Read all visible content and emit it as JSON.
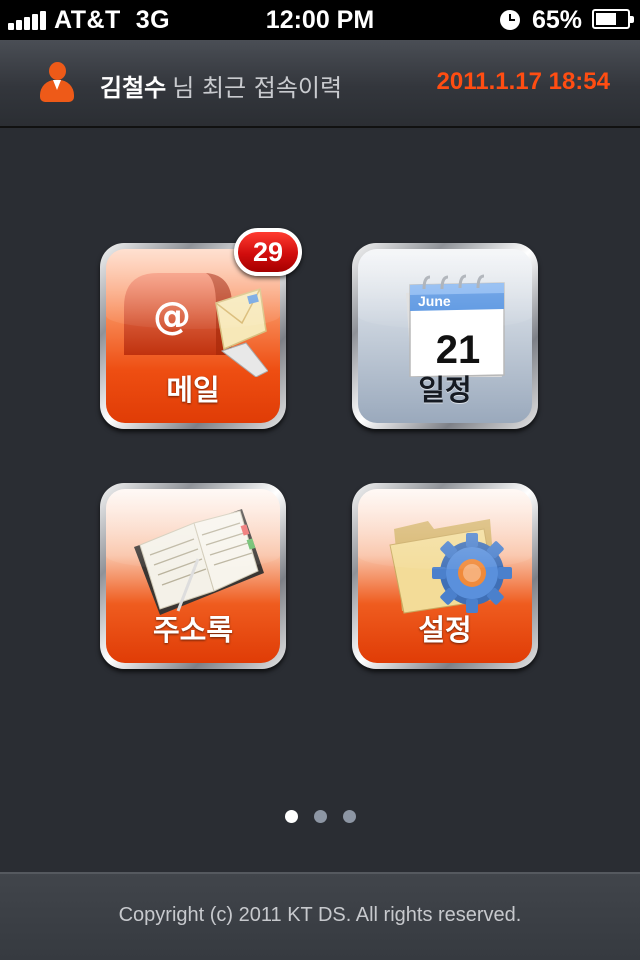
{
  "status_bar": {
    "carrier": "AT&T",
    "network": "3G",
    "time": "12:00 PM",
    "battery": "65%",
    "battery_level": 0.65,
    "signal_bars": 5
  },
  "header": {
    "user_name": "김철수",
    "suffix": "님 최근 접속이력",
    "timestamp": "2011.1.17 18:54",
    "timestamp_color": "#ff4d12"
  },
  "menu": {
    "mail": {
      "label": "메일",
      "badge": "29",
      "icon": "mailbox-icon"
    },
    "schedule": {
      "label": "일정",
      "icon": "calendar-icon",
      "month": "June",
      "day": "21"
    },
    "contacts": {
      "label": "주소록",
      "icon": "address-book-icon"
    },
    "settings": {
      "label": "설정",
      "icon": "folder-gear-icon"
    }
  },
  "pager": {
    "pages": 3,
    "current": 1
  },
  "footer": {
    "copyright": "Copyright (c) 2011 KT DS. All rights reserved."
  },
  "colors": {
    "accent": "#ee5a18",
    "badge": "#d10d0d",
    "background": "#2a2d33"
  }
}
